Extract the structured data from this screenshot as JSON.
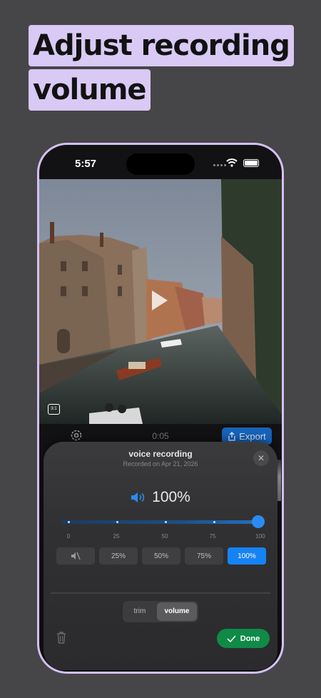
{
  "headline": {
    "line1": "Adjust recording",
    "line2": "volume"
  },
  "status_bar": {
    "time": "5:57"
  },
  "video": {
    "aspect_badge": "3:1"
  },
  "controls": {
    "current_time": "0:05",
    "export_label": "Export"
  },
  "sheet": {
    "title": "voice recording",
    "subtitle": "Recorded on Apr 21, 2026",
    "volume_percent": "100%",
    "volume_fraction": 1.0,
    "tick_labels": [
      "0",
      "25",
      "50",
      "75",
      "100"
    ],
    "presets": [
      {
        "label": "",
        "icon": "mute-icon",
        "active": false
      },
      {
        "label": "25%",
        "active": false
      },
      {
        "label": "50%",
        "active": false
      },
      {
        "label": "75%",
        "active": false
      },
      {
        "label": "100%",
        "active": true
      }
    ],
    "tabs": {
      "trim": "trim",
      "volume": "volume",
      "selected": "volume"
    },
    "done_label": "Done"
  },
  "colors": {
    "accent_blue": "#1683f5",
    "done_green": "#0f8a47",
    "headline_highlight": "#d9c9f5",
    "phone_frame": "#d4c0f2"
  }
}
